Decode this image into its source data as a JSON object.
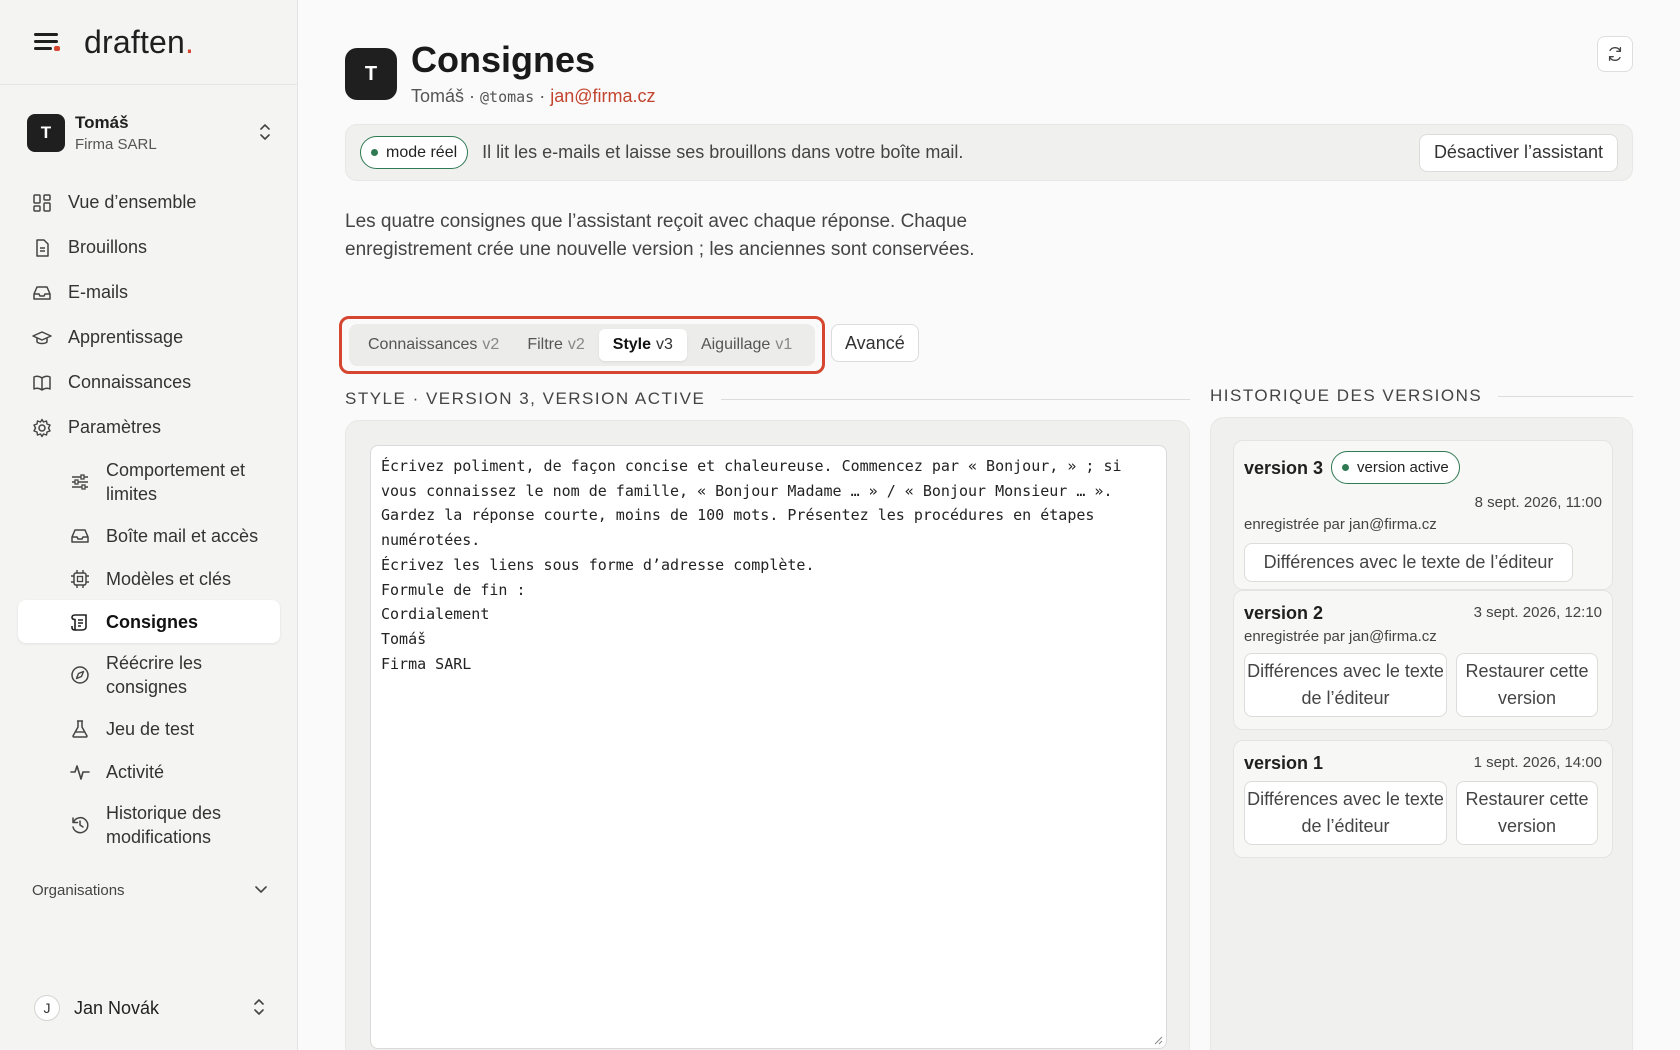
{
  "brand": {
    "name": "draften",
    "dot": "."
  },
  "account": {
    "initial": "T",
    "name": "Tomáš",
    "company": "Firma SARL"
  },
  "nav": {
    "overview": "Vue d’ensemble",
    "drafts": "Brouillons",
    "emails": "E-mails",
    "learning": "Apprentissage",
    "knowledge": "Connaissances",
    "settings": "Paramètres",
    "sub": {
      "behavior": "Comportement et limites",
      "mailbox": "Boîte mail et accès",
      "models": "Modèles et clés",
      "instructions": "Consignes",
      "rewrite": "Réécrire les consignes",
      "testset": "Jeu de test",
      "activity": "Activité",
      "history": "Historique des modifications"
    }
  },
  "orgs_label": "Organisations",
  "user": {
    "initial": "J",
    "name": "Jan Novák"
  },
  "header": {
    "initial": "T",
    "title": "Consignes",
    "name": "Tomáš",
    "sep": " · ",
    "handle": "@tomas",
    "email": "jan@firma.cz"
  },
  "mode": {
    "badge": "mode réel",
    "text": "Il lit les e-mails et laisse ses brouillons dans votre boîte mail.",
    "button": "Désactiver l’assistant"
  },
  "description": "Les quatre consignes que l’assistant reçoit avec chaque réponse. Chaque enregistrement crée une nouvelle version ; les anciennes sont conservées.",
  "tabs": [
    {
      "label": "Connaissances",
      "version": "v2"
    },
    {
      "label": "Filtre",
      "version": "v2"
    },
    {
      "label": "Style",
      "version": "v3"
    },
    {
      "label": "Aiguillage",
      "version": "v1"
    }
  ],
  "advanced_label": "Avancé",
  "editor": {
    "section_label": "STYLE · VERSION 3, VERSION ACTIVE",
    "content": "Écrivez poliment, de façon concise et chaleureuse. Commencez par « Bonjour, » ; si\nvous connaissez le nom de famille, « Bonjour Madame … » / « Bonjour Monsieur … ».\nGardez la réponse courte, moins de 100 mots. Présentez les procédures en étapes\nnumérotées.\nÉcrivez les liens sous forme d’adresse complète.\nFormule de fin :\nCordialement\nTomáš\nFirma SARL"
  },
  "history": {
    "section_label": "HISTORIQUE DES VERSIONS",
    "active_badge": "version active",
    "diff_label": "Différences avec le texte de l’éditeur",
    "diff_label_short": "Différences avec le texte de l’éditeur",
    "restore_label": "Restaurer cette version",
    "versions": [
      {
        "name": "version 3",
        "date": "8 sept. 2026, 11:00",
        "by": "enregistrée par jan@firma.cz"
      },
      {
        "name": "version 2",
        "date": "3 sept. 2026, 12:10",
        "by": "enregistrée par jan@firma.cz"
      },
      {
        "name": "version 1",
        "date": "1 sept. 2026, 14:00",
        "by": ""
      }
    ]
  },
  "colors": {
    "accent": "#d5452f",
    "success": "#2f7a52",
    "link": "#c2442e"
  }
}
